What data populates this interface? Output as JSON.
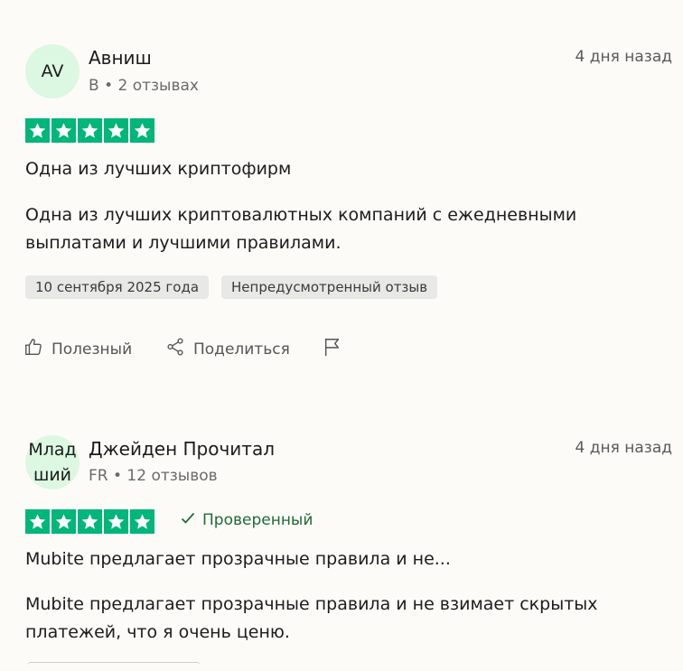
{
  "reviews": [
    {
      "avatar": "AV",
      "name": "Авниш",
      "meta": "B • 2 отзывах",
      "date": "4 дня назад",
      "rating": 5,
      "title": "Одна из лучших криптофирм",
      "body": "Одна из лучших криптовалютных компаний с ежедневными выплатами и лучшими правилами.",
      "chips": [
        "10 сентября 2025 года",
        "Непредусмотренный отзыв"
      ],
      "actions": {
        "helpful": "Полезный",
        "share": "Поделиться"
      }
    },
    {
      "avatar": "Млад\nший",
      "name": "Джейден Прочитал",
      "meta": "FR • 12 отзывов",
      "date": "4 дня назад",
      "rating": 5,
      "verified": "Проверенный",
      "title": "Mubite предлагает прозрачные правила и не...",
      "body": "Mubite предлагает прозрачные правила и не взимает скрытых платежей, что я очень ценю."
    }
  ],
  "colors": {
    "star_green": "#00b67a",
    "avatar_bg": "#dcf7e2",
    "verified_green": "#1f6b36",
    "chip_bg": "#e8e8e6"
  },
  "icons": [
    "thumbs-up-icon",
    "share-icon",
    "flag-icon",
    "check-icon",
    "star-icon"
  ]
}
